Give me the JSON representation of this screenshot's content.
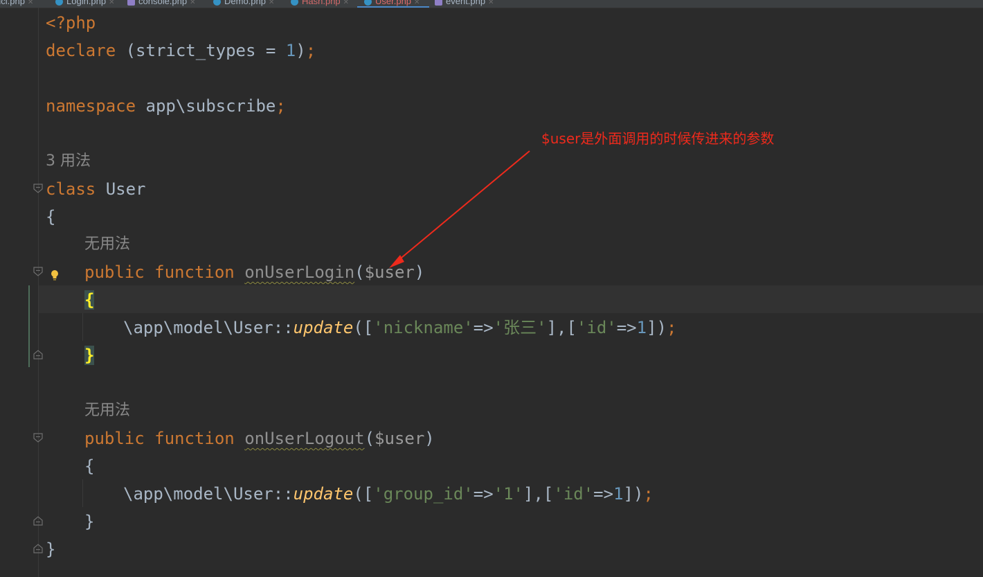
{
  "tabs": [
    {
      "label": "ucl.php",
      "icon": "php-file-icon"
    },
    {
      "label": "Login.php",
      "icon": "php-class-icon"
    },
    {
      "label": "console.php",
      "icon": "php-config-icon"
    },
    {
      "label": "Demo.php",
      "icon": "php-class-icon"
    },
    {
      "label": "Hash.php",
      "icon": "php-class-icon"
    },
    {
      "label": "User.php",
      "icon": "php-class-icon",
      "active": true
    },
    {
      "label": "event.php",
      "icon": "php-config-icon"
    }
  ],
  "code": {
    "l1": "<?php",
    "l2_kw": "declare",
    "l2_rest1": " (strict_types = ",
    "l2_num": "1",
    "l2_close": ")",
    "l2_semi": ";",
    "l4_kw": "namespace",
    "l4_ns": " app\\subscribe",
    "l4_semi": ";",
    "usages_class": "3 用法",
    "l6_kw": "class",
    "l6_name": " User",
    "l7": "{",
    "usages_m1": "无用法",
    "m1_public": "public",
    "m1_function": "function",
    "m1_name": "onUserLogin",
    "m1_open": "(",
    "m1_param": "$user",
    "m1_close": ")",
    "m1_brace_open": "{",
    "m1_body_ns": "\\app\\model\\User::",
    "m1_body_fn": "update",
    "m1_body_a": "([",
    "m1_body_s1": "'nickname'",
    "m1_body_arrow1": "=>",
    "m1_body_s2": "'张三'",
    "m1_body_b": "],[",
    "m1_body_s3": "'id'",
    "m1_body_arrow2": "=>",
    "m1_body_n": "1",
    "m1_body_c": "])",
    "m1_body_semi": ";",
    "m1_brace_close": "}",
    "usages_m2": "无用法",
    "m2_public": "public",
    "m2_function": "function",
    "m2_name": "onUserLogout",
    "m2_open": "(",
    "m2_param": "$user",
    "m2_close": ")",
    "m2_brace_open": "{",
    "m2_body_ns": "\\app\\model\\User::",
    "m2_body_fn": "update",
    "m2_body_a": "([",
    "m2_body_s1": "'group_id'",
    "m2_body_arrow1": "=>",
    "m2_body_s2": "'1'",
    "m2_body_b": "],[",
    "m2_body_s3": "'id'",
    "m2_body_arrow2": "=>",
    "m2_body_n": "1",
    "m2_body_c": "])",
    "m2_body_semi": ";",
    "m2_brace_close": "}",
    "class_close": "}"
  },
  "annotation": {
    "text": "$user是外面调用的时候传进来的参数",
    "color": "#ee2a1c"
  },
  "colors": {
    "background": "#2b2b2b",
    "keyword": "#cc7832",
    "number": "#6897bb",
    "string": "#6a8759",
    "method_call": "#ffc66d",
    "text": "#a9b7c6"
  }
}
